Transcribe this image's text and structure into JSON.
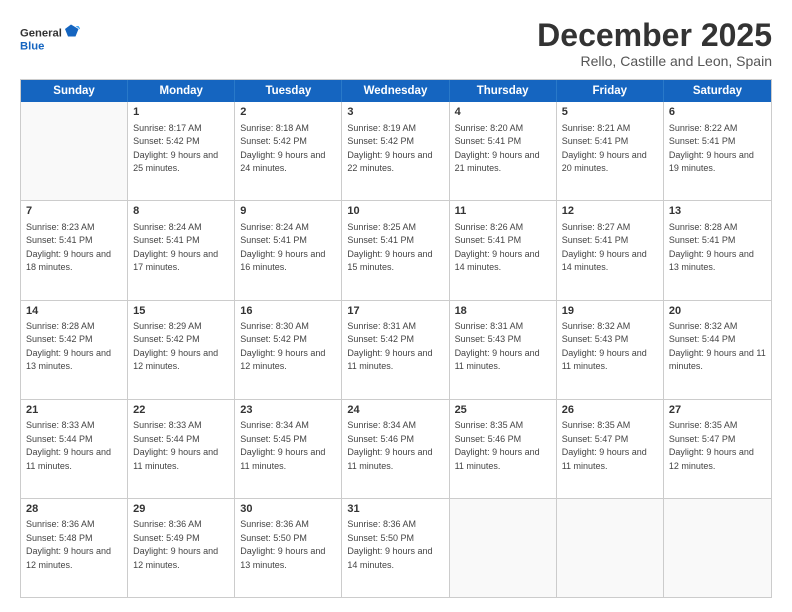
{
  "logo": {
    "line1": "General",
    "line2": "Blue"
  },
  "title": "December 2025",
  "subtitle": "Rello, Castille and Leon, Spain",
  "header_days": [
    "Sunday",
    "Monday",
    "Tuesday",
    "Wednesday",
    "Thursday",
    "Friday",
    "Saturday"
  ],
  "weeks": [
    [
      {
        "day": "",
        "info": "",
        "empty": true
      },
      {
        "day": "1",
        "info": "Sunrise: 8:17 AM\nSunset: 5:42 PM\nDaylight: 9 hours\nand 25 minutes."
      },
      {
        "day": "2",
        "info": "Sunrise: 8:18 AM\nSunset: 5:42 PM\nDaylight: 9 hours\nand 24 minutes."
      },
      {
        "day": "3",
        "info": "Sunrise: 8:19 AM\nSunset: 5:42 PM\nDaylight: 9 hours\nand 22 minutes."
      },
      {
        "day": "4",
        "info": "Sunrise: 8:20 AM\nSunset: 5:41 PM\nDaylight: 9 hours\nand 21 minutes."
      },
      {
        "day": "5",
        "info": "Sunrise: 8:21 AM\nSunset: 5:41 PM\nDaylight: 9 hours\nand 20 minutes."
      },
      {
        "day": "6",
        "info": "Sunrise: 8:22 AM\nSunset: 5:41 PM\nDaylight: 9 hours\nand 19 minutes."
      }
    ],
    [
      {
        "day": "7",
        "info": "Sunrise: 8:23 AM\nSunset: 5:41 PM\nDaylight: 9 hours\nand 18 minutes."
      },
      {
        "day": "8",
        "info": "Sunrise: 8:24 AM\nSunset: 5:41 PM\nDaylight: 9 hours\nand 17 minutes."
      },
      {
        "day": "9",
        "info": "Sunrise: 8:24 AM\nSunset: 5:41 PM\nDaylight: 9 hours\nand 16 minutes."
      },
      {
        "day": "10",
        "info": "Sunrise: 8:25 AM\nSunset: 5:41 PM\nDaylight: 9 hours\nand 15 minutes."
      },
      {
        "day": "11",
        "info": "Sunrise: 8:26 AM\nSunset: 5:41 PM\nDaylight: 9 hours\nand 14 minutes."
      },
      {
        "day": "12",
        "info": "Sunrise: 8:27 AM\nSunset: 5:41 PM\nDaylight: 9 hours\nand 14 minutes."
      },
      {
        "day": "13",
        "info": "Sunrise: 8:28 AM\nSunset: 5:41 PM\nDaylight: 9 hours\nand 13 minutes."
      }
    ],
    [
      {
        "day": "14",
        "info": "Sunrise: 8:28 AM\nSunset: 5:42 PM\nDaylight: 9 hours\nand 13 minutes."
      },
      {
        "day": "15",
        "info": "Sunrise: 8:29 AM\nSunset: 5:42 PM\nDaylight: 9 hours\nand 12 minutes."
      },
      {
        "day": "16",
        "info": "Sunrise: 8:30 AM\nSunset: 5:42 PM\nDaylight: 9 hours\nand 12 minutes."
      },
      {
        "day": "17",
        "info": "Sunrise: 8:31 AM\nSunset: 5:42 PM\nDaylight: 9 hours\nand 11 minutes."
      },
      {
        "day": "18",
        "info": "Sunrise: 8:31 AM\nSunset: 5:43 PM\nDaylight: 9 hours\nand 11 minutes."
      },
      {
        "day": "19",
        "info": "Sunrise: 8:32 AM\nSunset: 5:43 PM\nDaylight: 9 hours\nand 11 minutes."
      },
      {
        "day": "20",
        "info": "Sunrise: 8:32 AM\nSunset: 5:44 PM\nDaylight: 9 hours\nand 11 minutes."
      }
    ],
    [
      {
        "day": "21",
        "info": "Sunrise: 8:33 AM\nSunset: 5:44 PM\nDaylight: 9 hours\nand 11 minutes."
      },
      {
        "day": "22",
        "info": "Sunrise: 8:33 AM\nSunset: 5:44 PM\nDaylight: 9 hours\nand 11 minutes."
      },
      {
        "day": "23",
        "info": "Sunrise: 8:34 AM\nSunset: 5:45 PM\nDaylight: 9 hours\nand 11 minutes."
      },
      {
        "day": "24",
        "info": "Sunrise: 8:34 AM\nSunset: 5:46 PM\nDaylight: 9 hours\nand 11 minutes."
      },
      {
        "day": "25",
        "info": "Sunrise: 8:35 AM\nSunset: 5:46 PM\nDaylight: 9 hours\nand 11 minutes."
      },
      {
        "day": "26",
        "info": "Sunrise: 8:35 AM\nSunset: 5:47 PM\nDaylight: 9 hours\nand 11 minutes."
      },
      {
        "day": "27",
        "info": "Sunrise: 8:35 AM\nSunset: 5:47 PM\nDaylight: 9 hours\nand 12 minutes."
      }
    ],
    [
      {
        "day": "28",
        "info": "Sunrise: 8:36 AM\nSunset: 5:48 PM\nDaylight: 9 hours\nand 12 minutes."
      },
      {
        "day": "29",
        "info": "Sunrise: 8:36 AM\nSunset: 5:49 PM\nDaylight: 9 hours\nand 12 minutes."
      },
      {
        "day": "30",
        "info": "Sunrise: 8:36 AM\nSunset: 5:50 PM\nDaylight: 9 hours\nand 13 minutes."
      },
      {
        "day": "31",
        "info": "Sunrise: 8:36 AM\nSunset: 5:50 PM\nDaylight: 9 hours\nand 14 minutes."
      },
      {
        "day": "",
        "info": "",
        "empty": true
      },
      {
        "day": "",
        "info": "",
        "empty": true
      },
      {
        "day": "",
        "info": "",
        "empty": true
      }
    ]
  ]
}
